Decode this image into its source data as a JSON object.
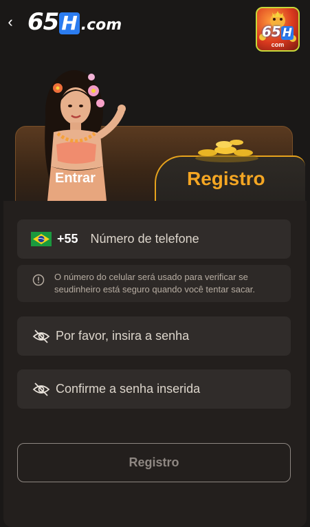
{
  "header": {
    "back_glyph": "‹",
    "brand_number": "65",
    "brand_letter": "H",
    "brand_domain": ".com",
    "app_icon": {
      "number": "65",
      "letter": "H",
      "domain": "com"
    }
  },
  "tabs": {
    "login_label": "Entrar",
    "register_label": "Registro",
    "active": "register"
  },
  "form": {
    "phone": {
      "country_code": "+55",
      "placeholder": "Número de telefone",
      "flag": "brazil-flag-icon"
    },
    "notice_text": "O número do celular será usado para verificar se seudinheiro está seguro quando você tentar sacar.",
    "password_placeholder": "Por favor, insira a senha",
    "confirm_password_placeholder": "Confirme a senha inserida",
    "submit_label": "Registro"
  },
  "colors": {
    "background": "#1a1817",
    "accent": "#f4a623",
    "field_bg": "#302c2a",
    "brand_blue": "#2b7cf0"
  }
}
